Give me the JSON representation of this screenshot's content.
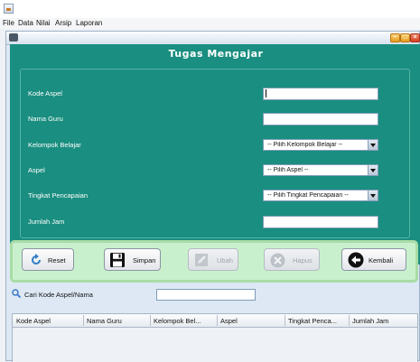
{
  "menu": [
    "File",
    "Data",
    "Nilai",
    "Arsip",
    "Laporan"
  ],
  "form": {
    "title": "Tugas Mengajar",
    "fields": [
      {
        "label": "Kode Aspel",
        "type": "text",
        "value": ""
      },
      {
        "label": "Nama Guru",
        "type": "text",
        "value": ""
      },
      {
        "label": "Kelompok Belajar",
        "type": "combo",
        "value": "-- Pilih Kelompok Belajar --"
      },
      {
        "label": "Aspel",
        "type": "combo",
        "value": "-- Pilih Aspel --"
      },
      {
        "label": "Tingkat Pencapaian",
        "type": "combo",
        "value": "-- Pilih Tingkat Pencapaian --"
      },
      {
        "label": "Jumlah Jam",
        "type": "text",
        "value": ""
      }
    ]
  },
  "buttons": {
    "reset": "Reset",
    "simpan": "Simpan",
    "ubah": "Ubah",
    "hapus": "Hapus",
    "kembali": "Kembali"
  },
  "search": {
    "label": "Cari Kode Aspel/Nama",
    "value": ""
  },
  "table": {
    "columns": [
      "Kode Aspel",
      "Nama Guru",
      "Kelompok Bel...",
      "Aspel",
      "Tingkat Penca...",
      "Jumlah Jam"
    ],
    "rows": []
  },
  "colors": {
    "form_panel": "#1a8e80",
    "button_panel": "#c9f0cd"
  }
}
